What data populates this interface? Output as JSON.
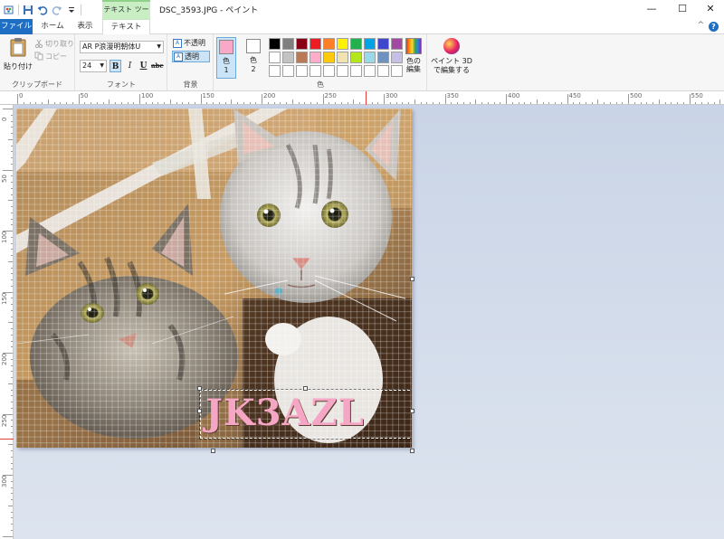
{
  "window": {
    "title": "DSC_3593.JPG - ペイント",
    "context_group": "テキスト ツール",
    "minimize": "—",
    "maximize": "☐",
    "close": "✕"
  },
  "tabs": {
    "file": "ファイル",
    "home": "ホーム",
    "view": "表示",
    "text": "テキスト",
    "collapse": "^",
    "help": "?"
  },
  "ribbon": {
    "clipboard": {
      "label": "クリップボード",
      "paste": "貼り付け",
      "cut": "切り取り",
      "copy": "コピー"
    },
    "font": {
      "label": "フォント",
      "family": "AR P浪漫明朝体U",
      "size": "24",
      "bold": "B",
      "italic": "I",
      "underline": "U",
      "strike": "abc"
    },
    "background": {
      "label": "背景",
      "opaque": "不透明",
      "transparent": "透明"
    },
    "colors": {
      "label": "色",
      "color1_label": "色",
      "color1_num": "1",
      "color2_label": "色",
      "color2_num": "2",
      "color1": "#f9a8c8",
      "color2": "#ffffff",
      "edit_label_1": "色の",
      "edit_label_2": "編集",
      "palette": [
        "#000000",
        "#7f7f7f",
        "#880015",
        "#ed1c24",
        "#ff7f27",
        "#fff200",
        "#22b14c",
        "#00a2e8",
        "#3f48cc",
        "#a349a4",
        "#ffffff",
        "#c3c3c3",
        "#b97a57",
        "#ffaec9",
        "#ffc90e",
        "#efe4b0",
        "#b5e61d",
        "#99d9ea",
        "#7092be",
        "#c8bfe7",
        "#ffffff",
        "#ffffff",
        "#ffffff",
        "#ffffff",
        "#ffffff",
        "#ffffff",
        "#ffffff",
        "#ffffff",
        "#ffffff",
        "#ffffff"
      ]
    },
    "paint3d": {
      "line1": "ペイント 3D",
      "line2": "で編集する"
    }
  },
  "ruler": {
    "h_labels": [
      "0",
      "50",
      "100",
      "150",
      "200",
      "250",
      "300",
      "350",
      "400",
      "450",
      "500",
      "550"
    ],
    "v_labels": [
      "0",
      "50",
      "100",
      "150",
      "200",
      "250",
      "300"
    ]
  },
  "canvas": {
    "text_content": "JK3AZL",
    "text_color": "#f5a6c4"
  }
}
